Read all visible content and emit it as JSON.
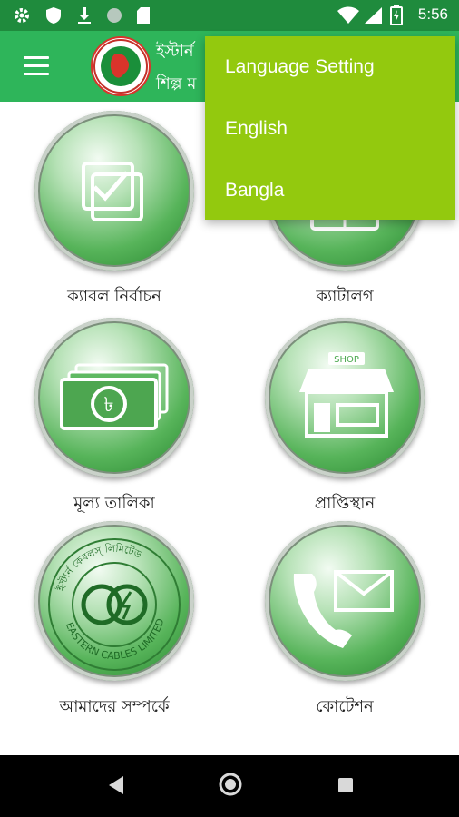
{
  "status_bar": {
    "time": "5:56",
    "icons": [
      "gear-icon",
      "shield-icon",
      "download-icon",
      "circle-icon",
      "sd-card-icon",
      "wifi-icon",
      "signal-icon",
      "battery-icon"
    ]
  },
  "app_bar": {
    "title_line1": "ইস্টার্ন",
    "title_line2": "শিল্প ম"
  },
  "grid": {
    "items": [
      {
        "label": "ক্যাবল নির্বাচন",
        "icon": "checkbox-icon"
      },
      {
        "label": "ক্যাটালগ",
        "icon": "catalog-icon"
      },
      {
        "label": "মূল্য তালিকা",
        "icon": "money-icon"
      },
      {
        "label": "প্রাপ্তিস্থান",
        "icon": "shop-icon"
      },
      {
        "label": "আমাদের সম্পর্কে",
        "icon": "company-seal-icon"
      },
      {
        "label": "কোটেশন",
        "icon": "phone-mail-icon"
      }
    ]
  },
  "seal_text": {
    "top": "ইস্টার্ন কেবলস্ লিমিটেড",
    "bottom": "EASTERN CABLES LIMITED"
  },
  "shop_sign": "SHOP",
  "dropdown": {
    "title": "Language Setting",
    "options": [
      "English",
      "Bangla"
    ]
  },
  "colors": {
    "status_bar": "#1f8b3d",
    "app_bar": "#2eb55a",
    "dropdown": "#93c90e"
  }
}
